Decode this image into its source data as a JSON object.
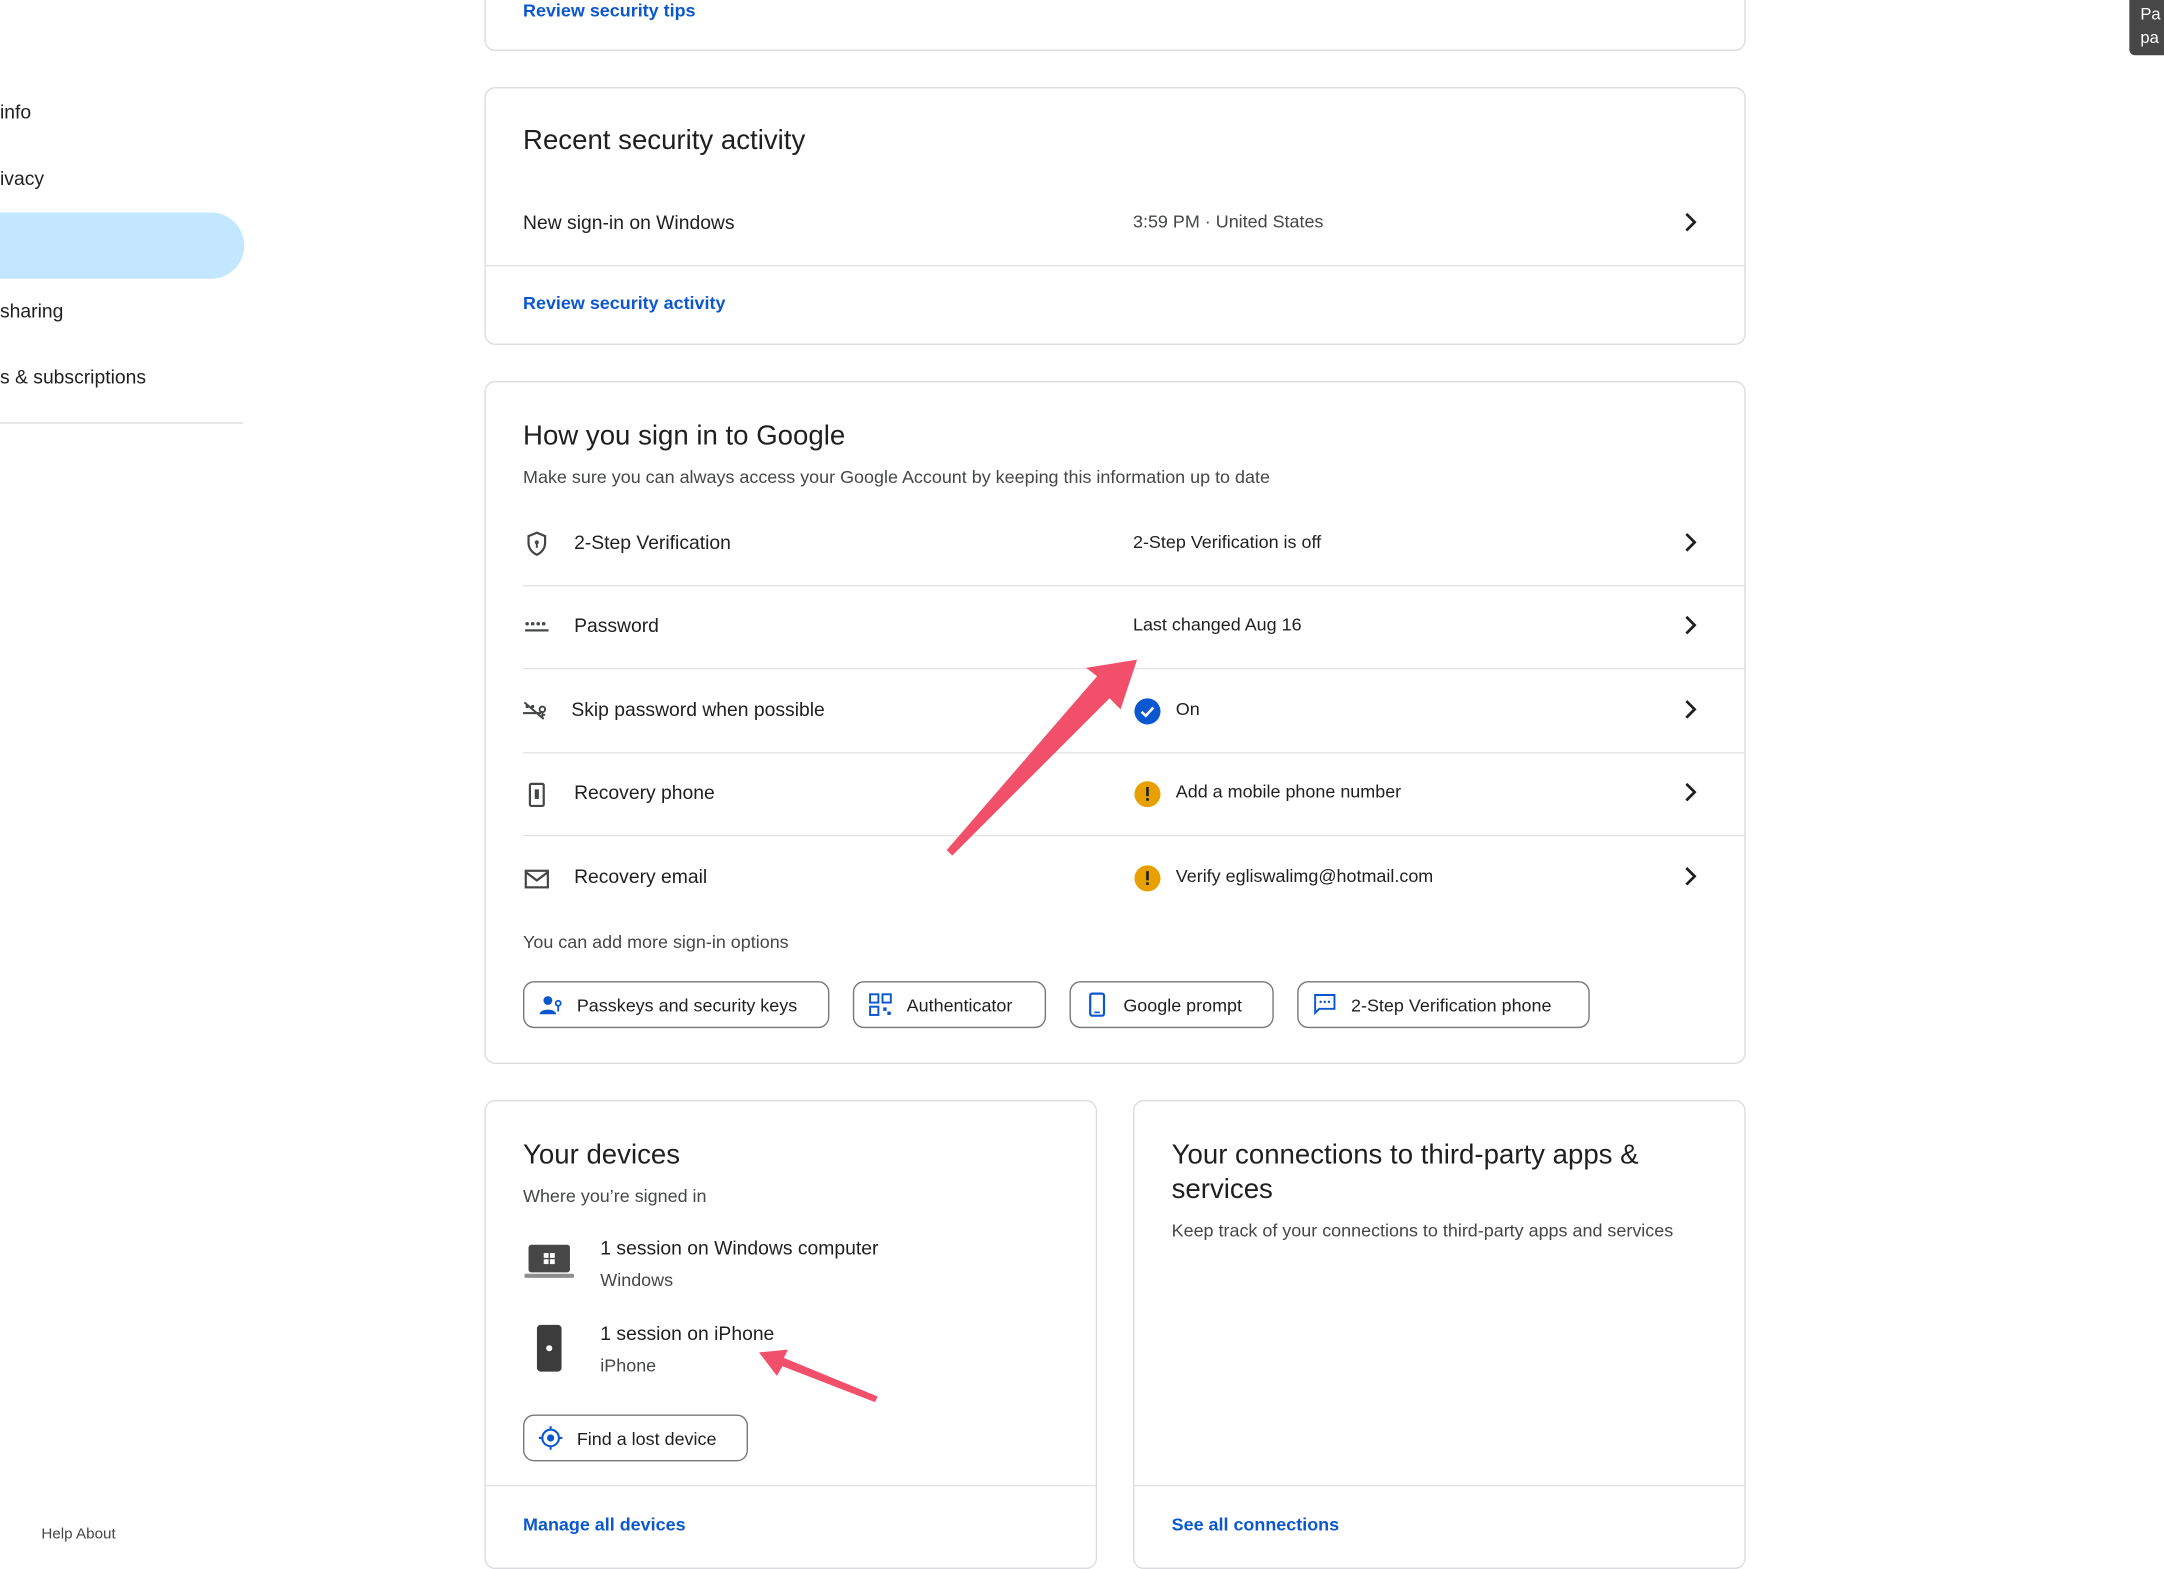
{
  "sidebar": {
    "items": [
      {
        "label": "info"
      },
      {
        "label": "ivacy"
      },
      {
        "label": ""
      },
      {
        "label": "sharing"
      },
      {
        "label": "s & subscriptions"
      }
    ],
    "footer": "Help     About"
  },
  "top_card": {
    "link": "Review security tips"
  },
  "recent_activity": {
    "title": "Recent security activity",
    "event": "New sign-in on Windows",
    "event_detail": "3:59 PM · United States",
    "link": "Review security activity"
  },
  "signin": {
    "title": "How you sign in to Google",
    "subtitle": "Make sure you can always access your Google Account by keeping this information up to date",
    "rows": [
      {
        "label": "2-Step Verification",
        "value": "2-Step Verification is off",
        "icon": "shield-icon"
      },
      {
        "label": "Password",
        "value": "Last changed Aug 16",
        "icon": "password-dots-icon"
      },
      {
        "label": "Skip password when possible",
        "value": "On",
        "icon": "passkey-icon",
        "status": "check"
      },
      {
        "label": "Recovery phone",
        "value": "Add a mobile phone number",
        "icon": "phone-icon",
        "status": "warning"
      },
      {
        "label": "Recovery email",
        "value": "Verify egliswalimg@hotmail.com",
        "icon": "mail-icon",
        "status": "warning"
      }
    ],
    "more_label": "You can add more sign-in options",
    "options": [
      {
        "label": "Passkeys and security keys",
        "icon": "passkey-person-icon"
      },
      {
        "label": "Authenticator",
        "icon": "qr-icon"
      },
      {
        "label": "Google prompt",
        "icon": "phone-outline-icon"
      },
      {
        "label": "2-Step Verification phone",
        "icon": "sms-icon"
      }
    ]
  },
  "devices": {
    "title": "Your devices",
    "subtitle": "Where you’re signed in",
    "items": [
      {
        "name": "1 session on Windows computer",
        "os": "Windows",
        "icon": "windows-laptop-icon"
      },
      {
        "name": "1 session on iPhone",
        "os": "iPhone",
        "icon": "iphone-icon"
      }
    ],
    "find_button": "Find a lost device",
    "link": "Manage all devices"
  },
  "connections": {
    "title_line1": "Your connections to third-party apps &",
    "title_line2": "services",
    "subtitle": "Keep track of your connections to third-party apps and services",
    "link": "See all connections"
  },
  "corner_chip": {
    "line1": "Pa",
    "line2": "pa"
  },
  "colors": {
    "accent": "#0b57d0",
    "active_nav": "#c2e7ff",
    "annotation_arrow": "#f2506a",
    "warning": "#e8a000",
    "check": "#0b57d0"
  }
}
